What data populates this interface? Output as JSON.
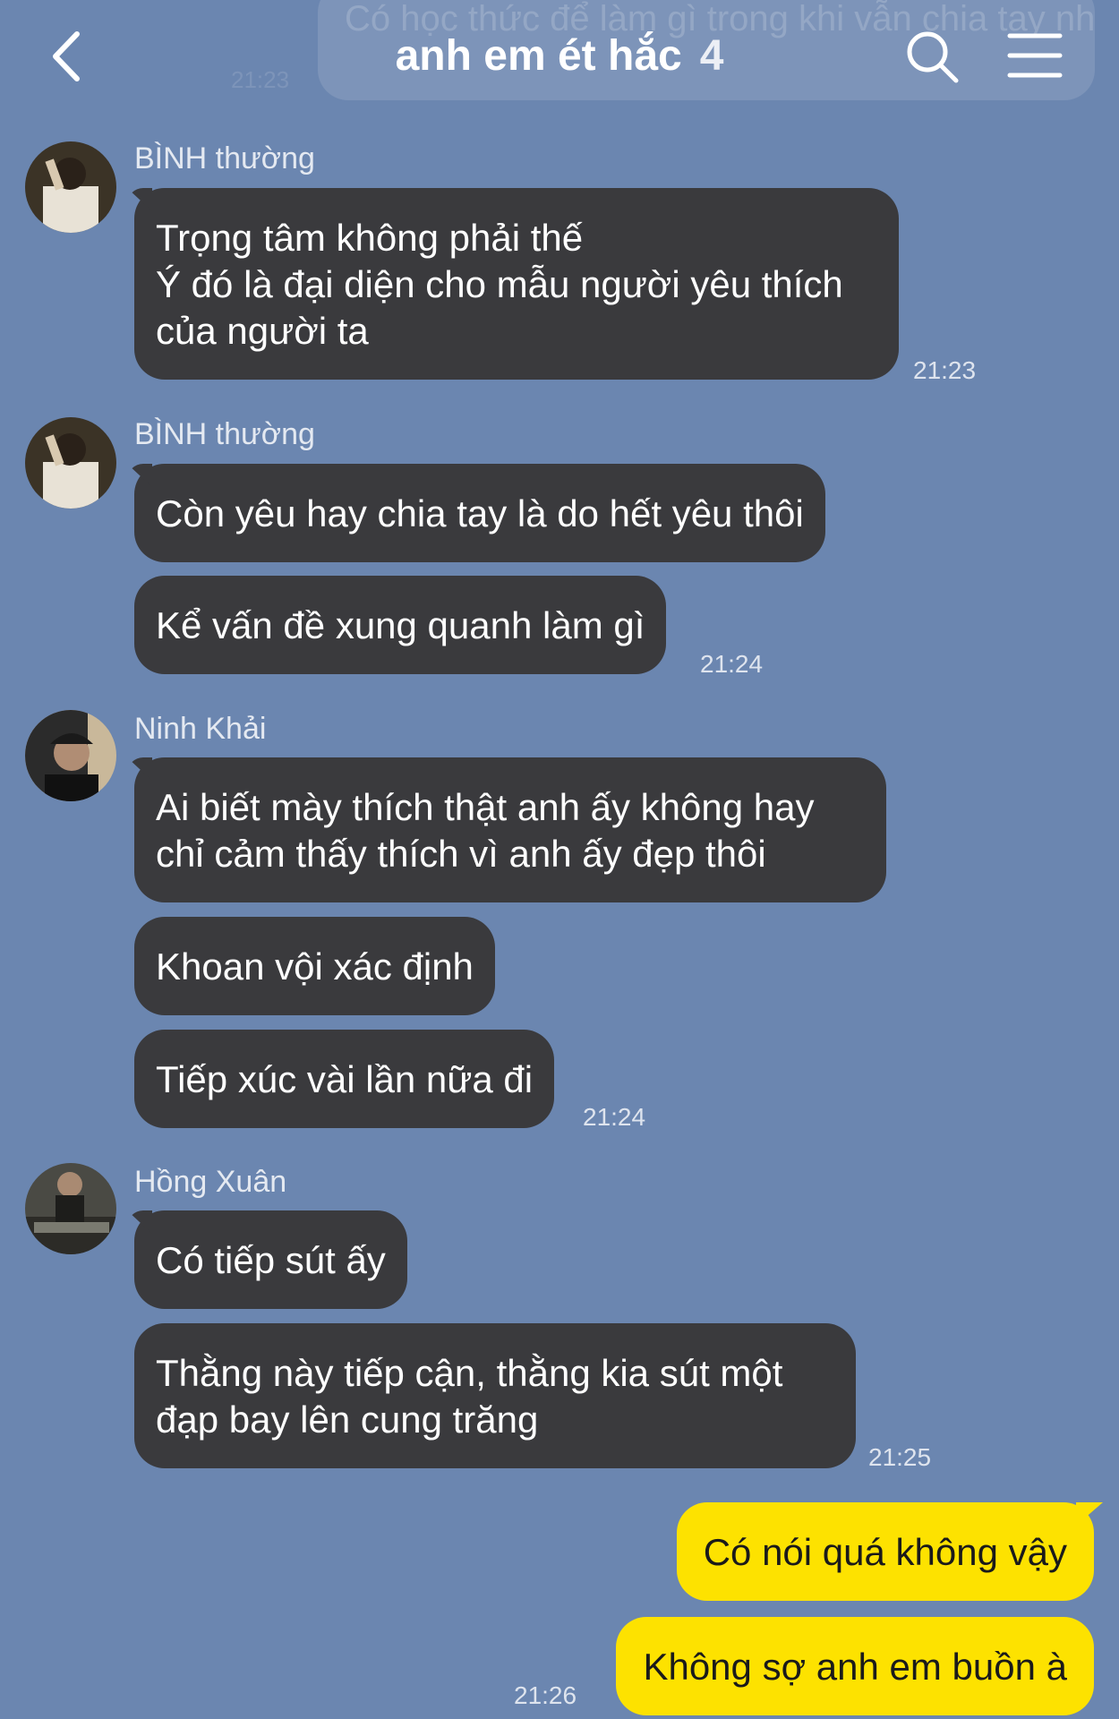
{
  "header": {
    "title": "anh em ét hắc",
    "member_count": "4",
    "ghost_text": "Có học thức để làm gì trong khi vẫn chia tay như thôi",
    "ghost_time": "21:23"
  },
  "icons": {
    "back": "chevron-left",
    "search": "magnifier",
    "menu": "hamburger"
  },
  "colors": {
    "background": "#6b86b0",
    "incoming_bubble": "#3a3a3d",
    "outgoing_bubble": "#fde200"
  },
  "messages": {
    "group1": {
      "sender": "BÌNH thường",
      "texts": [
        "Trọng tâm không phải thế\nÝ đó là đại diện cho mẫu người yêu thích của người ta"
      ],
      "time": "21:23"
    },
    "group2": {
      "sender": "BÌNH thường",
      "texts": [
        "Còn yêu hay chia tay là do hết yêu thôi",
        "Kể vấn đề xung quanh làm gì"
      ],
      "time": "21:24"
    },
    "group3": {
      "sender": "Ninh Khải",
      "texts": [
        "Ai biết mày thích thật anh ấy không hay chỉ cảm thấy thích vì anh ấy đẹp thôi",
        "Khoan vội xác định",
        "Tiếp xúc vài lần nữa đi"
      ],
      "time": "21:24"
    },
    "group4": {
      "sender": "Hồng Xuân",
      "texts": [
        "Có tiếp sút ấy",
        "Thằng này tiếp cận, thằng kia sút một đạp bay lên cung trăng"
      ],
      "time": "21:25"
    },
    "mine": {
      "texts": [
        "Có nói quá không vậy",
        "Không sợ anh em buồn à"
      ],
      "time": "21:26"
    }
  }
}
